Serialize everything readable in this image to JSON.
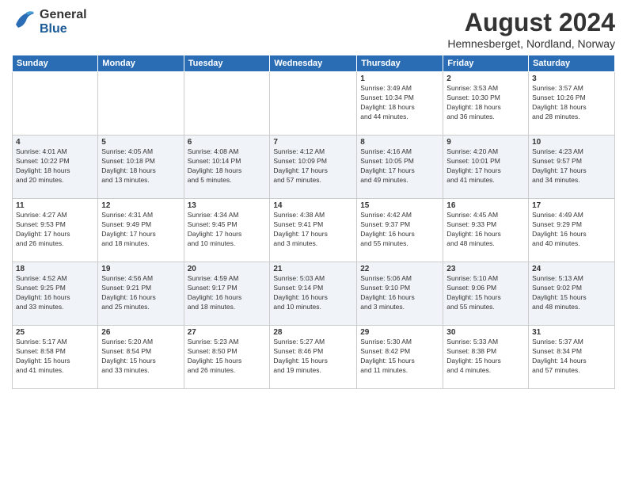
{
  "logo": {
    "general": "General",
    "blue": "Blue"
  },
  "title": "August 2024",
  "subtitle": "Hemnesberget, Nordland, Norway",
  "days_of_week": [
    "Sunday",
    "Monday",
    "Tuesday",
    "Wednesday",
    "Thursday",
    "Friday",
    "Saturday"
  ],
  "weeks": [
    [
      {
        "day": "",
        "info": ""
      },
      {
        "day": "",
        "info": ""
      },
      {
        "day": "",
        "info": ""
      },
      {
        "day": "",
        "info": ""
      },
      {
        "day": "1",
        "info": "Sunrise: 3:49 AM\nSunset: 10:34 PM\nDaylight: 18 hours\nand 44 minutes."
      },
      {
        "day": "2",
        "info": "Sunrise: 3:53 AM\nSunset: 10:30 PM\nDaylight: 18 hours\nand 36 minutes."
      },
      {
        "day": "3",
        "info": "Sunrise: 3:57 AM\nSunset: 10:26 PM\nDaylight: 18 hours\nand 28 minutes."
      }
    ],
    [
      {
        "day": "4",
        "info": "Sunrise: 4:01 AM\nSunset: 10:22 PM\nDaylight: 18 hours\nand 20 minutes."
      },
      {
        "day": "5",
        "info": "Sunrise: 4:05 AM\nSunset: 10:18 PM\nDaylight: 18 hours\nand 13 minutes."
      },
      {
        "day": "6",
        "info": "Sunrise: 4:08 AM\nSunset: 10:14 PM\nDaylight: 18 hours\nand 5 minutes."
      },
      {
        "day": "7",
        "info": "Sunrise: 4:12 AM\nSunset: 10:09 PM\nDaylight: 17 hours\nand 57 minutes."
      },
      {
        "day": "8",
        "info": "Sunrise: 4:16 AM\nSunset: 10:05 PM\nDaylight: 17 hours\nand 49 minutes."
      },
      {
        "day": "9",
        "info": "Sunrise: 4:20 AM\nSunset: 10:01 PM\nDaylight: 17 hours\nand 41 minutes."
      },
      {
        "day": "10",
        "info": "Sunrise: 4:23 AM\nSunset: 9:57 PM\nDaylight: 17 hours\nand 34 minutes."
      }
    ],
    [
      {
        "day": "11",
        "info": "Sunrise: 4:27 AM\nSunset: 9:53 PM\nDaylight: 17 hours\nand 26 minutes."
      },
      {
        "day": "12",
        "info": "Sunrise: 4:31 AM\nSunset: 9:49 PM\nDaylight: 17 hours\nand 18 minutes."
      },
      {
        "day": "13",
        "info": "Sunrise: 4:34 AM\nSunset: 9:45 PM\nDaylight: 17 hours\nand 10 minutes."
      },
      {
        "day": "14",
        "info": "Sunrise: 4:38 AM\nSunset: 9:41 PM\nDaylight: 17 hours\nand 3 minutes."
      },
      {
        "day": "15",
        "info": "Sunrise: 4:42 AM\nSunset: 9:37 PM\nDaylight: 16 hours\nand 55 minutes."
      },
      {
        "day": "16",
        "info": "Sunrise: 4:45 AM\nSunset: 9:33 PM\nDaylight: 16 hours\nand 48 minutes."
      },
      {
        "day": "17",
        "info": "Sunrise: 4:49 AM\nSunset: 9:29 PM\nDaylight: 16 hours\nand 40 minutes."
      }
    ],
    [
      {
        "day": "18",
        "info": "Sunrise: 4:52 AM\nSunset: 9:25 PM\nDaylight: 16 hours\nand 33 minutes."
      },
      {
        "day": "19",
        "info": "Sunrise: 4:56 AM\nSunset: 9:21 PM\nDaylight: 16 hours\nand 25 minutes."
      },
      {
        "day": "20",
        "info": "Sunrise: 4:59 AM\nSunset: 9:17 PM\nDaylight: 16 hours\nand 18 minutes."
      },
      {
        "day": "21",
        "info": "Sunrise: 5:03 AM\nSunset: 9:14 PM\nDaylight: 16 hours\nand 10 minutes."
      },
      {
        "day": "22",
        "info": "Sunrise: 5:06 AM\nSunset: 9:10 PM\nDaylight: 16 hours\nand 3 minutes."
      },
      {
        "day": "23",
        "info": "Sunrise: 5:10 AM\nSunset: 9:06 PM\nDaylight: 15 hours\nand 55 minutes."
      },
      {
        "day": "24",
        "info": "Sunrise: 5:13 AM\nSunset: 9:02 PM\nDaylight: 15 hours\nand 48 minutes."
      }
    ],
    [
      {
        "day": "25",
        "info": "Sunrise: 5:17 AM\nSunset: 8:58 PM\nDaylight: 15 hours\nand 41 minutes."
      },
      {
        "day": "26",
        "info": "Sunrise: 5:20 AM\nSunset: 8:54 PM\nDaylight: 15 hours\nand 33 minutes."
      },
      {
        "day": "27",
        "info": "Sunrise: 5:23 AM\nSunset: 8:50 PM\nDaylight: 15 hours\nand 26 minutes."
      },
      {
        "day": "28",
        "info": "Sunrise: 5:27 AM\nSunset: 8:46 PM\nDaylight: 15 hours\nand 19 minutes."
      },
      {
        "day": "29",
        "info": "Sunrise: 5:30 AM\nSunset: 8:42 PM\nDaylight: 15 hours\nand 11 minutes."
      },
      {
        "day": "30",
        "info": "Sunrise: 5:33 AM\nSunset: 8:38 PM\nDaylight: 15 hours\nand 4 minutes."
      },
      {
        "day": "31",
        "info": "Sunrise: 5:37 AM\nSunset: 8:34 PM\nDaylight: 14 hours\nand 57 minutes."
      }
    ]
  ]
}
